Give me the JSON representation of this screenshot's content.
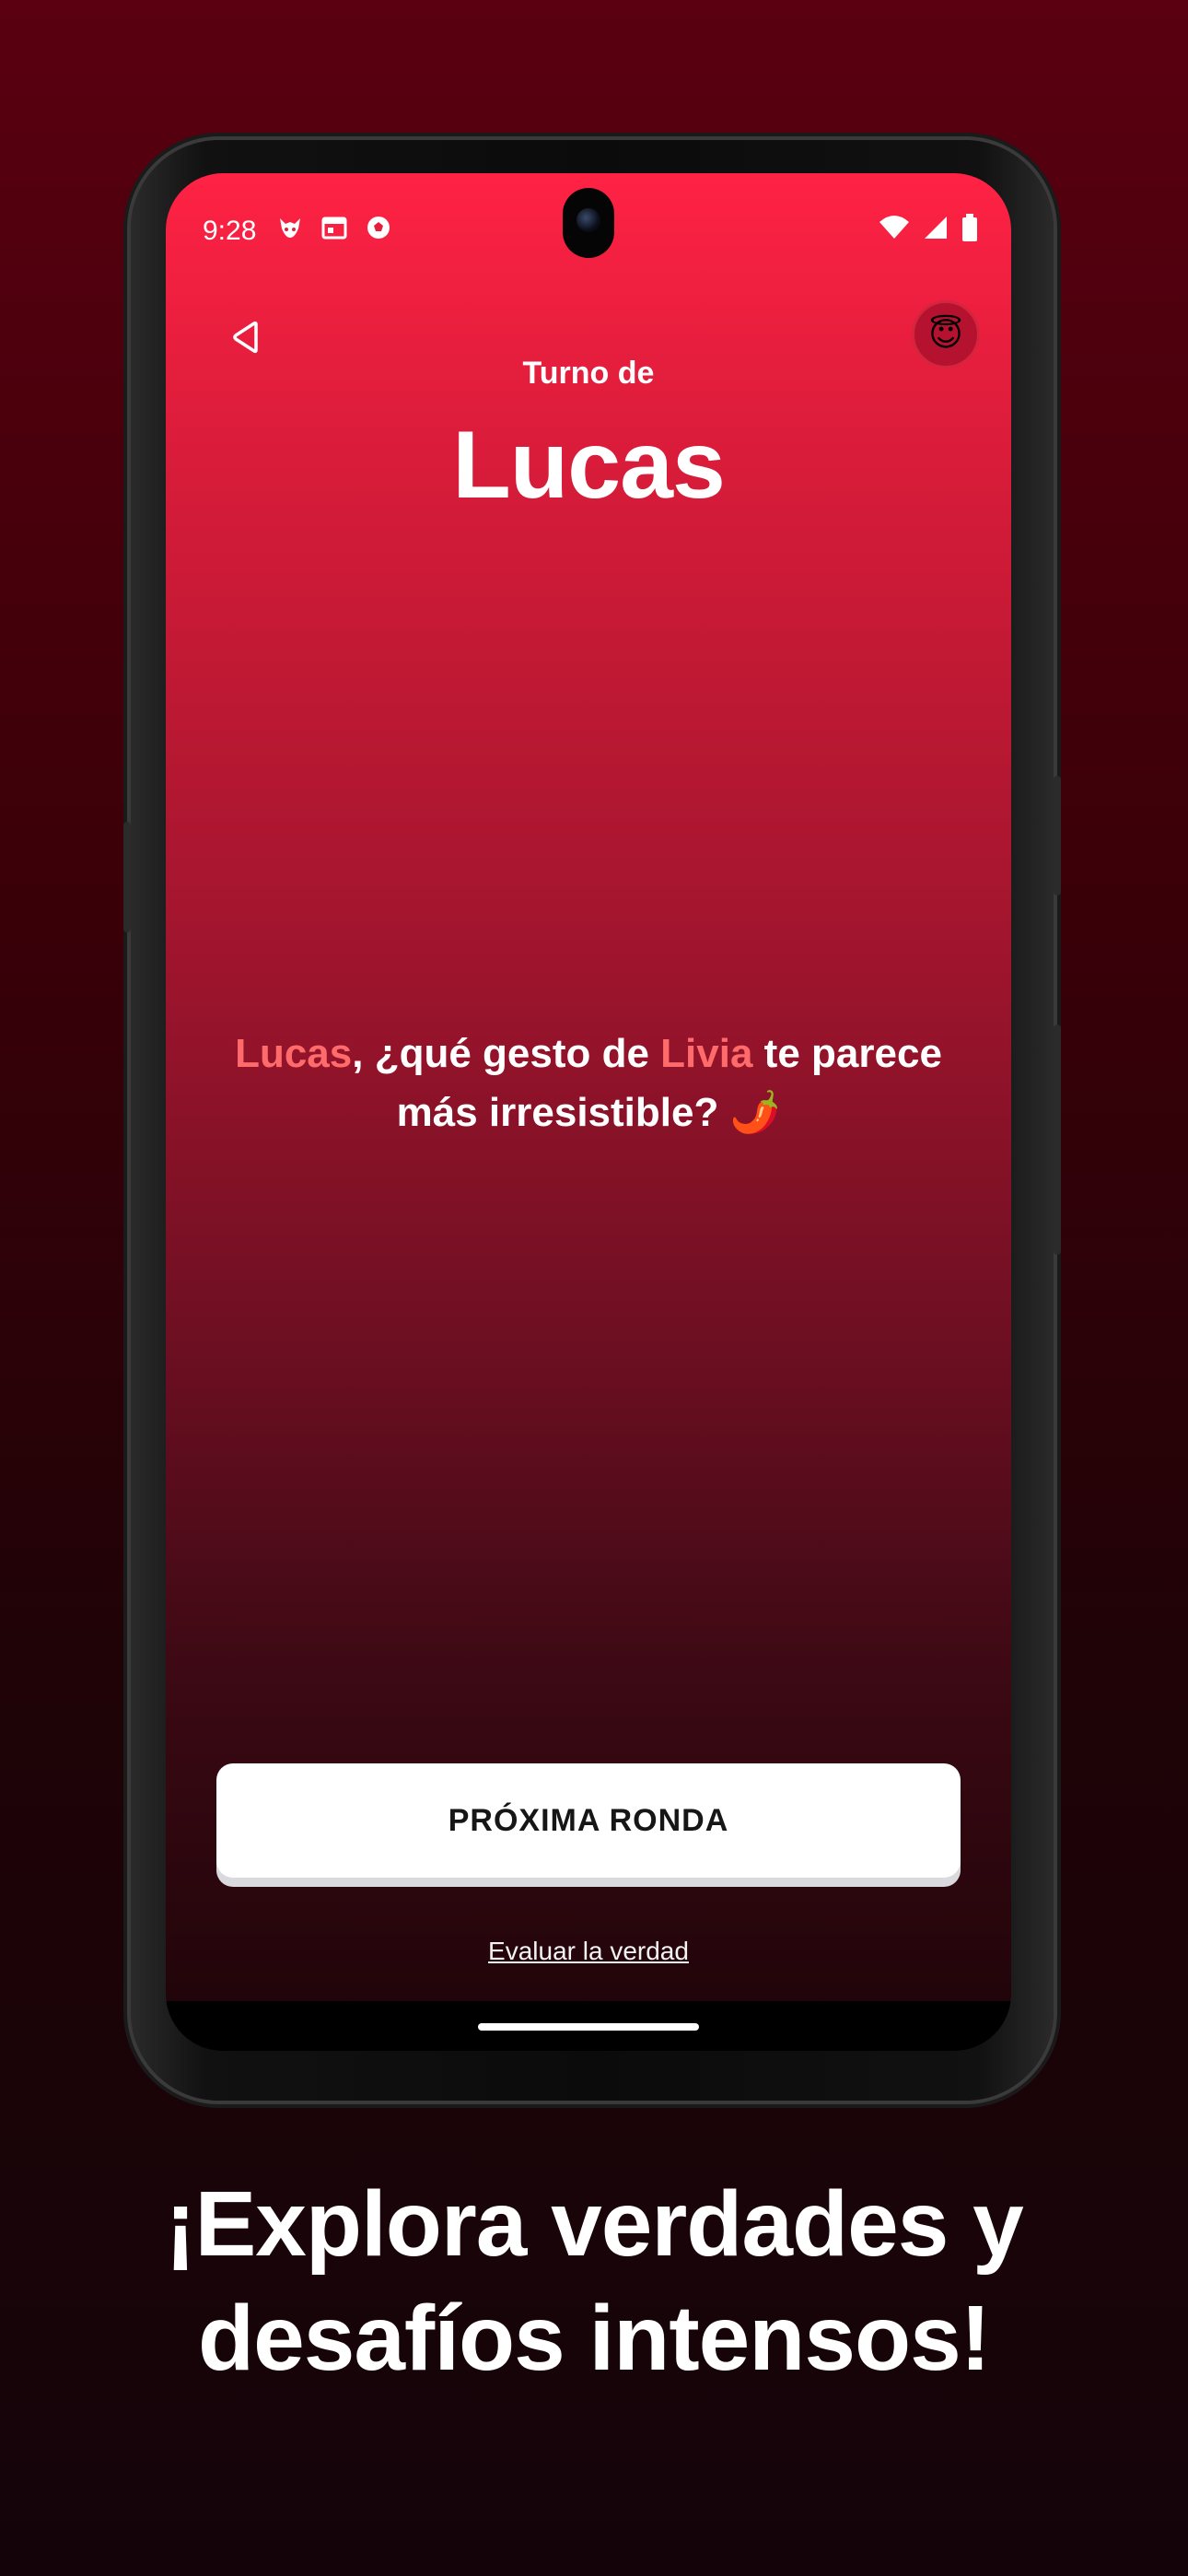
{
  "status_bar": {
    "time": "9:28",
    "left_icons": [
      "app-devil-icon",
      "calendar-icon",
      "soccer-ball-icon"
    ],
    "right_icons": [
      "wifi-icon",
      "signal-icon",
      "battery-icon"
    ]
  },
  "header": {
    "turn_label": "Turno de",
    "player_name": "Lucas",
    "avatar_emoji": "😇"
  },
  "question": {
    "part1_name": "Lucas",
    "part2": ", ¿qué gesto de ",
    "part3_name": "Livia",
    "part4": " te parece más irresistible? ",
    "emoji": "🌶️"
  },
  "actions": {
    "next_round_label": "PRÓXIMA RONDA",
    "evaluate_link": "Evaluar la verdad"
  },
  "promo": {
    "headline_line1": "¡Explora verdades y",
    "headline_line2": "desafíos intensos!"
  },
  "colors": {
    "accent": "#ff2244",
    "highlight": "#ff6b6b"
  }
}
